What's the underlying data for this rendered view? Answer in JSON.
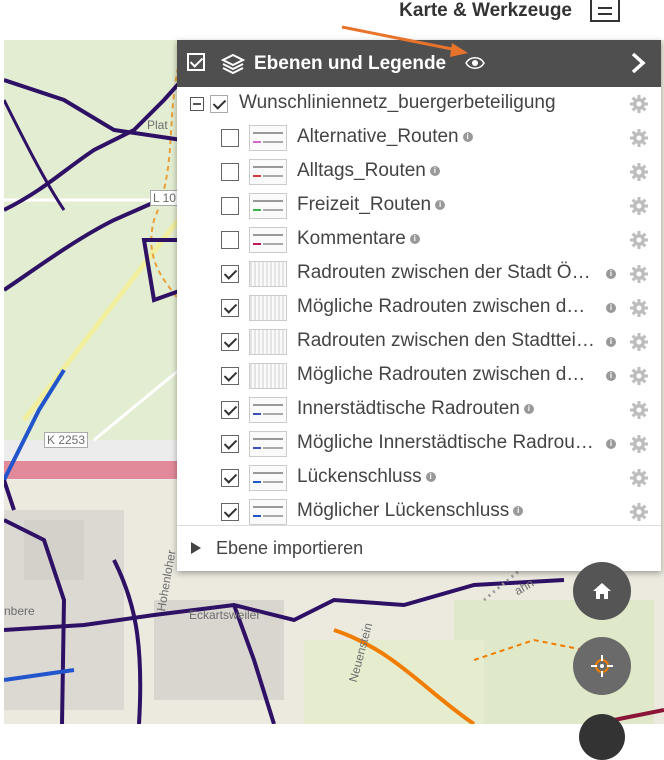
{
  "topbar": {
    "title": "Karte & Werkzeuge"
  },
  "map": {
    "labels": [
      "Plat",
      "L 10",
      "K 2253",
      "Eckartsweiler",
      "Neuenstein",
      "Hohenloher",
      "nbere",
      "ahn"
    ]
  },
  "panel": {
    "title": "Ebenen und Legende",
    "root": {
      "label": "Wunschliniennetz_buergerbeteiligung",
      "checked": true
    },
    "layers": [
      {
        "label": "Alternative_Routen",
        "checked": false,
        "info": "inline",
        "swatch": "#d06acb"
      },
      {
        "label": "Alltags_Routen",
        "checked": false,
        "info": "inline",
        "swatch": "#d33a3a"
      },
      {
        "label": "Freizeit_Routen",
        "checked": false,
        "info": "inline",
        "swatch": "#3cb44b"
      },
      {
        "label": "Kommentare",
        "checked": false,
        "info": "inline",
        "swatch": "#c2185b"
      },
      {
        "label": "Radrouten zwischen der Stadt Ö…",
        "checked": true,
        "info": "right",
        "swatch": ""
      },
      {
        "label": "Mögliche Radrouten zwischen d…",
        "checked": true,
        "info": "right",
        "swatch": ""
      },
      {
        "label": "Radrouten zwischen den Stadttei…",
        "checked": true,
        "info": "right",
        "swatch": ""
      },
      {
        "label": "Mögliche Radrouten zwischen d…",
        "checked": true,
        "info": "right",
        "swatch": ""
      },
      {
        "label": "Innerstädtische Radrouten",
        "checked": true,
        "info": "inline",
        "swatch": "#3b4fb8"
      },
      {
        "label": "Mögliche Innerstädtische Radrou…",
        "checked": true,
        "info": "right",
        "swatch": "#3b4fb8"
      },
      {
        "label": "Lückenschluss",
        "checked": true,
        "info": "inline",
        "swatch": "#2255cc"
      },
      {
        "label": "Möglicher Lückenschluss",
        "checked": true,
        "info": "inline",
        "swatch": "#2255cc"
      }
    ],
    "import_label": "Ebene importieren"
  },
  "colors": {
    "header": "#4f4f4f",
    "accent_arrow": "#e8732a",
    "route_purple": "#2e1065",
    "route_orange": "#f07d00"
  }
}
